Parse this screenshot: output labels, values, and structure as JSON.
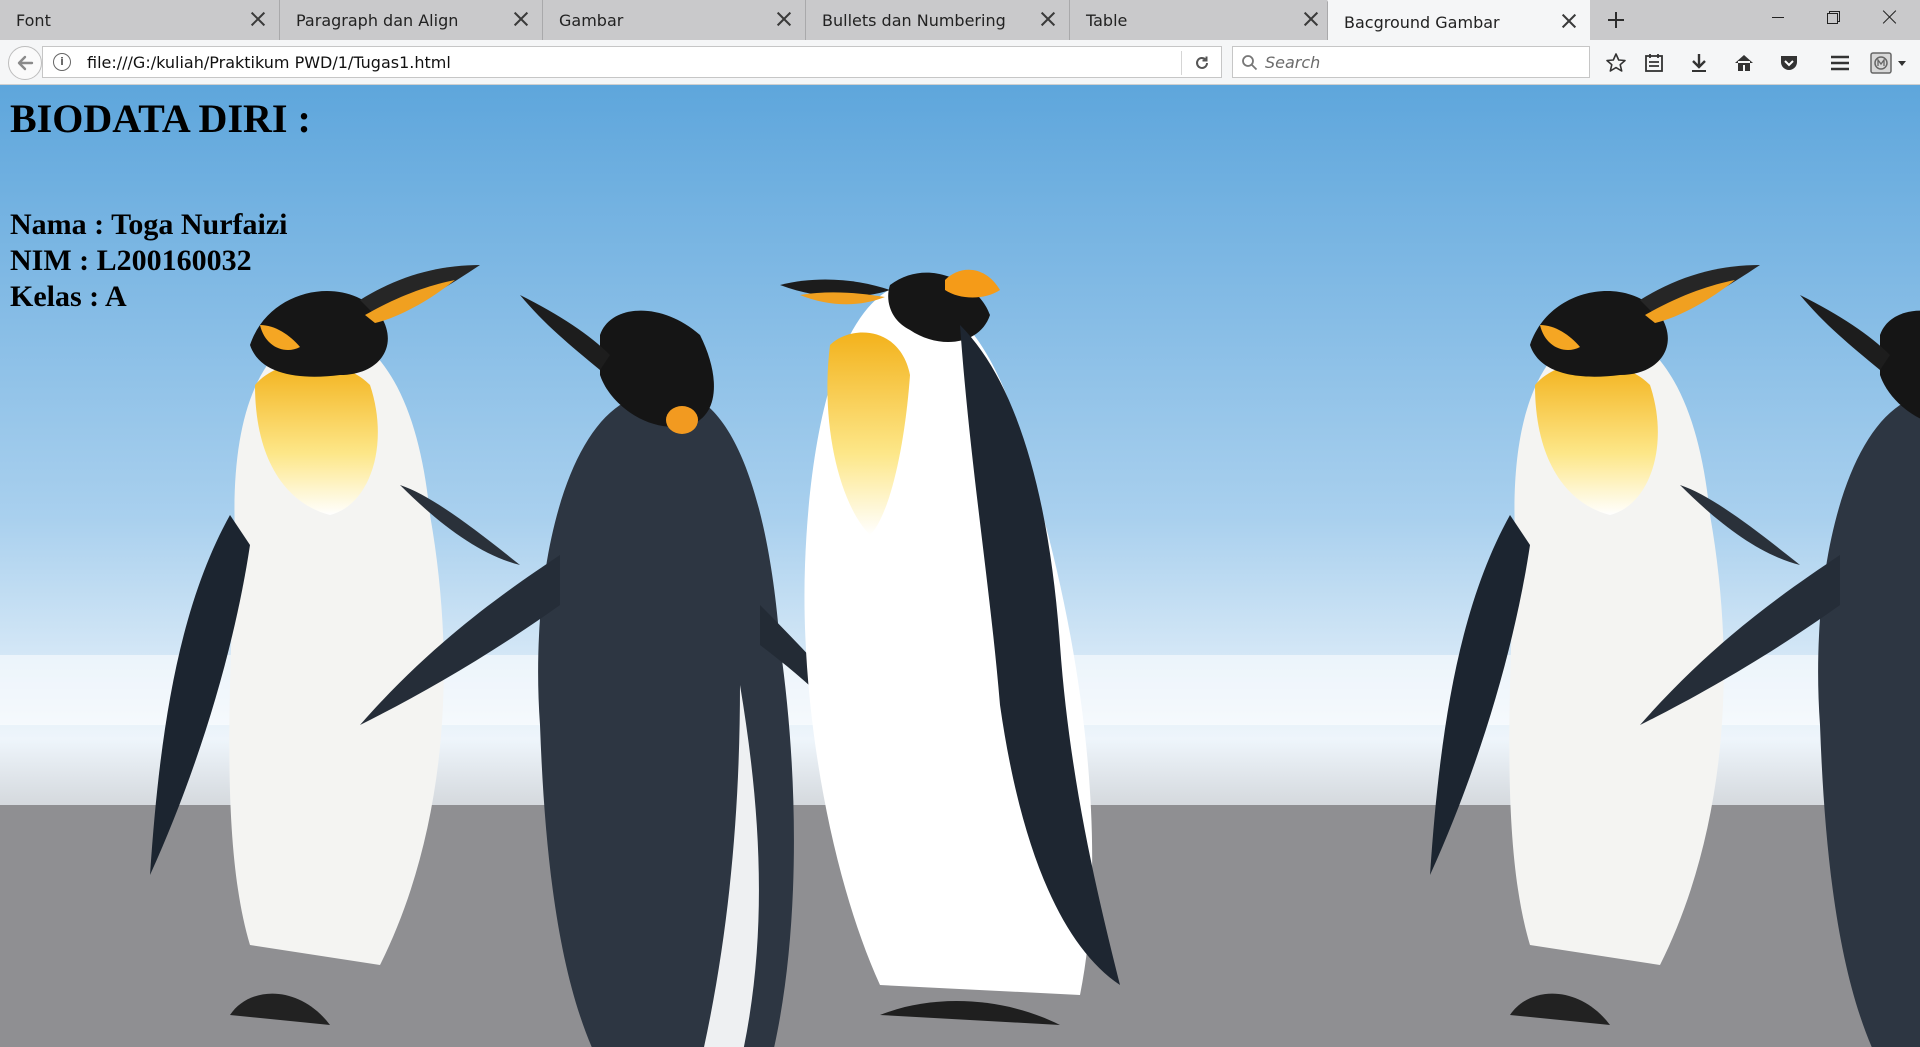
{
  "tabs": [
    {
      "label": "Font",
      "active": false
    },
    {
      "label": "Paragraph dan Align",
      "active": false
    },
    {
      "label": "Gambar",
      "active": false
    },
    {
      "label": "Bullets dan Numbering",
      "active": false
    },
    {
      "label": "Table",
      "active": false
    },
    {
      "label": "Bacground Gambar",
      "active": true
    }
  ],
  "navbar": {
    "url": "file:///G:/kuliah/Praktikum PWD/1/Tugas1.html",
    "search_placeholder": "Search"
  },
  "page": {
    "heading": "BIODATA DIRI :",
    "lines": [
      "Nama : Toga Nurfaizi",
      "NIM : L200160032",
      "Kelas : A"
    ]
  },
  "colors": {
    "sky": "#8fc4ea",
    "sand": "#9a9a9c",
    "tabstrip": "#c9c9cb"
  }
}
